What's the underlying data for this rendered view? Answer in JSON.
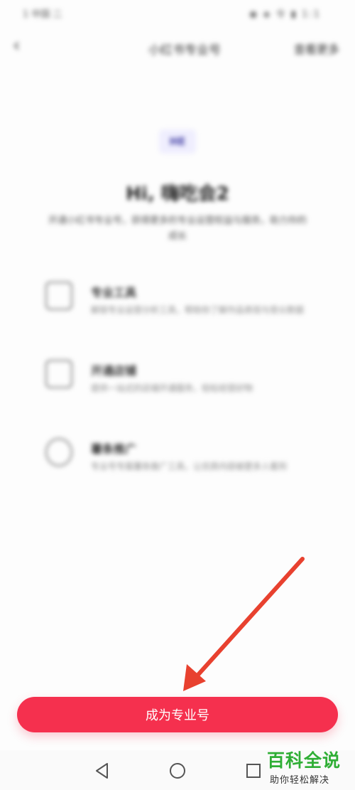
{
  "status_bar": {
    "left_text": "1 中国 二",
    "right_text": "◉ ◈ 令 ▮ 1:1"
  },
  "header": {
    "title": "小红书专业号",
    "action_label": "查看更多"
  },
  "badge_text": "HE",
  "headline": "Hi, 嗨吃会2",
  "intro": "开通小红书专业号，获得更多的专业运营权益与服务，助力你的成长",
  "features": [
    {
      "icon": "tool-icon",
      "title": "专业工具",
      "desc": "解锁专业运营分析工具，帮助你了解作品表现与受众数据"
    },
    {
      "icon": "shop-icon",
      "title": "开通店铺",
      "desc": "提供一站式的店铺开通服务，轻松经营好物"
    },
    {
      "icon": "promote-icon",
      "title": "薯条推广",
      "desc": "专业号专属薯条推广工具，让优质内容被更多人看到"
    }
  ],
  "cta_label": "成为专业号",
  "watermark": {
    "title": "百科全说",
    "subtitle": "助你轻松解决"
  },
  "colors": {
    "accent": "#f5304e",
    "arrow": "#e8412f",
    "watermark": "#2fae35"
  }
}
